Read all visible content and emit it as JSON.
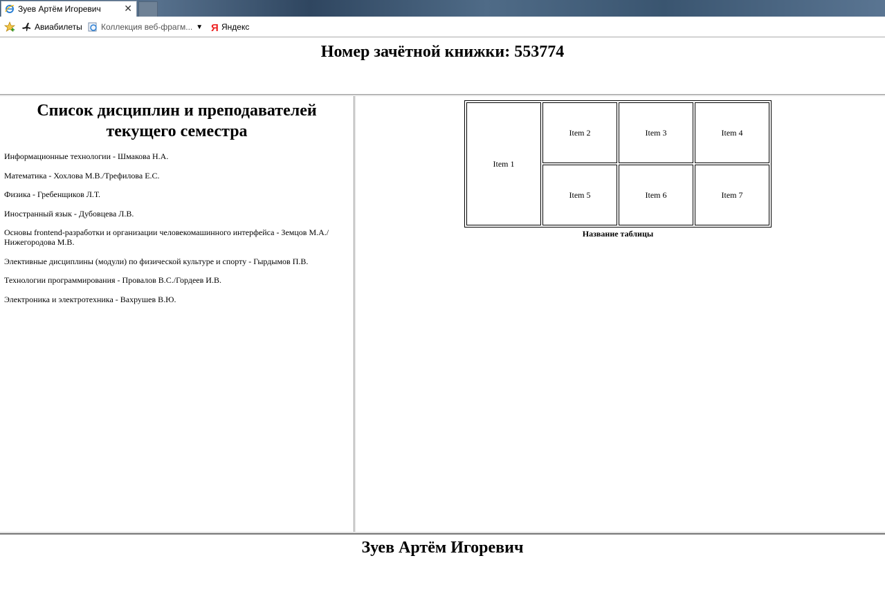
{
  "browser": {
    "tab_title": "Зуев Артём Игоревич",
    "favorites": [
      {
        "label": "Авиабилеты",
        "icon": "airplane-icon"
      },
      {
        "label": "Коллекция веб-фрагм...",
        "icon": "web-slice-icon"
      },
      {
        "label": "Яндекс",
        "icon": "yandex-icon"
      }
    ],
    "colors": {
      "accent": "#3d5a78"
    }
  },
  "header": {
    "title": "Номер зачётной книжки: 553774"
  },
  "left": {
    "heading": "Список дисциплин и преподавателей текущего семестра",
    "items": [
      "Информационные технологии - Шмакова Н.А.",
      "Математика - Хохлова М.В./Трефилова Е.С.",
      "Физика - Гребенщиков Л.Т.",
      "Иностранный язык - Дубовцева Л.В.",
      "Основы frontend-разработки и организации человекомашинного интерфейса - Земцов М.А./Нижегородова М.В.",
      "Элективные дисциплины (модули) по физической культуре и спорту - Гырдымов П.В.",
      "Технологии программирования - Провалов В.С./Гордеев И.В.",
      "Электроника и электротехника - Вахрушев В.Ю."
    ]
  },
  "table": {
    "caption": "Название таблицы",
    "cells": [
      "Item 1",
      "Item 2",
      "Item 3",
      "Item 4",
      "Item 5",
      "Item 6",
      "Item 7"
    ]
  },
  "footer": {
    "name": "Зуев Артём Игоревич"
  }
}
